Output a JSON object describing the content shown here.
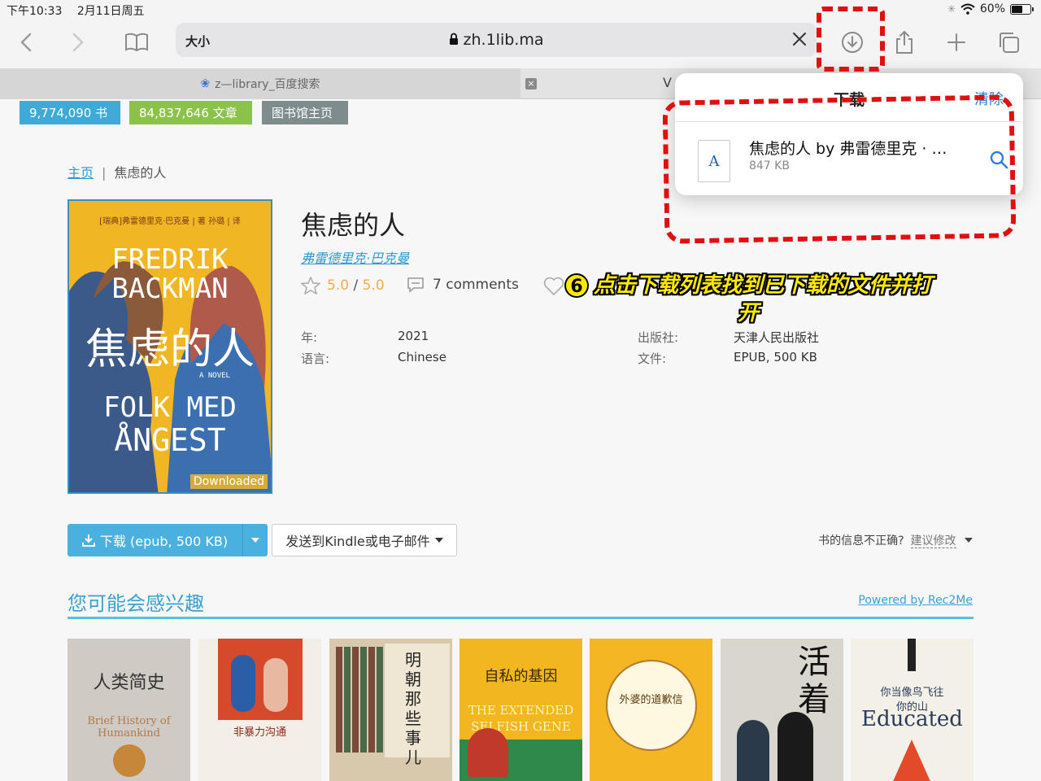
{
  "status": {
    "time": "下午10:33",
    "date": "2月11日周五",
    "battery": "60%"
  },
  "browser": {
    "text_size": "大小",
    "url": "zh.1lib.ma",
    "tab_active": "z—library_百度搜索",
    "tab_close": "×",
    "tab_partial": "V"
  },
  "stats": [
    {
      "label": "9,774,090 书",
      "color": "#3fa9d8"
    },
    {
      "label": "84,837,646 文章",
      "color": "#8bc34a"
    },
    {
      "label": "图书馆主页",
      "color": "#7f8c8d"
    }
  ],
  "breadcrumb": {
    "home": "主页",
    "sep": "|",
    "current": "焦虑的人"
  },
  "book": {
    "cover": {
      "top_line": "[瑞典]弗雷德里克·巴克曼 | 著    孙璐 | 译",
      "line1": "FREDRIK",
      "line2": "BACKMAN",
      "cn": "焦虑的人",
      "novel": "A NOVEL",
      "line3": "FOLK MED",
      "line4": "ÅNGEST",
      "badge": "Downloaded"
    },
    "title": "焦虑的人",
    "author": "弗雷德里克·巴克曼",
    "rating": "5.0",
    "rating_sep": "/",
    "rating_max": "5.0",
    "comments": "7 comments",
    "details": {
      "year_label": "年:",
      "year": "2021",
      "lang_label": "语言:",
      "lang": "Chinese",
      "publisher_label": "出版社:",
      "publisher": "天津人民出版社",
      "file_label": "文件:",
      "file": "EPUB, 500 KB"
    }
  },
  "actions": {
    "download": "下载 (epub, 500 KB)",
    "kindle": "发送到Kindle或电子邮件",
    "report_q": "书的信息不正确?",
    "report_link": "建议修改"
  },
  "recommend": {
    "heading": "您可能会感兴趣",
    "powered": "Powered by Rec2Me",
    "books": [
      {
        "title": "人类简史",
        "sub": "Brief History of Humankind",
        "bg": "#cfcbc4",
        "fg": "#333"
      },
      {
        "title": "非暴力沟通",
        "sub": "",
        "bg": "#f3efe8",
        "fg": "#8a2a1a"
      },
      {
        "title": "明朝那些事儿",
        "sub": "",
        "bg": "#d8c9ac",
        "fg": "#222"
      },
      {
        "title": "自私的基因",
        "sub": "THE EXTENDED SELFISH GENE",
        "bg": "#f2b61f",
        "fg": "#3a2a0a"
      },
      {
        "title": "外婆的道歉信",
        "sub": "",
        "bg": "#f4b622",
        "fg": "#5a3a10"
      },
      {
        "title": "活着",
        "sub": "",
        "bg": "#d9d6cd",
        "fg": "#111"
      },
      {
        "title": "你当像鸟飞往你的山",
        "sub": "Educated",
        "bg": "#f3f0e8",
        "fg": "#2a3a5a"
      }
    ]
  },
  "popover": {
    "title": "下载",
    "clear": "清除",
    "file_name": "焦虑的人 by 弗雷德里克 · …",
    "file_size": "847 KB",
    "file_icon": "A"
  },
  "annotation": {
    "num": "6",
    "text": "点击下载列表找到已下载的文件并打开"
  },
  "icons": [
    "back-icon",
    "forward-icon",
    "bookmarks-icon",
    "lock-icon",
    "clear-url-icon",
    "downloads-icon",
    "share-icon",
    "new-tab-icon",
    "tabs-icon",
    "wifi-icon",
    "battery-icon",
    "star-icon",
    "comment-icon",
    "heart-icon",
    "search-icon"
  ]
}
